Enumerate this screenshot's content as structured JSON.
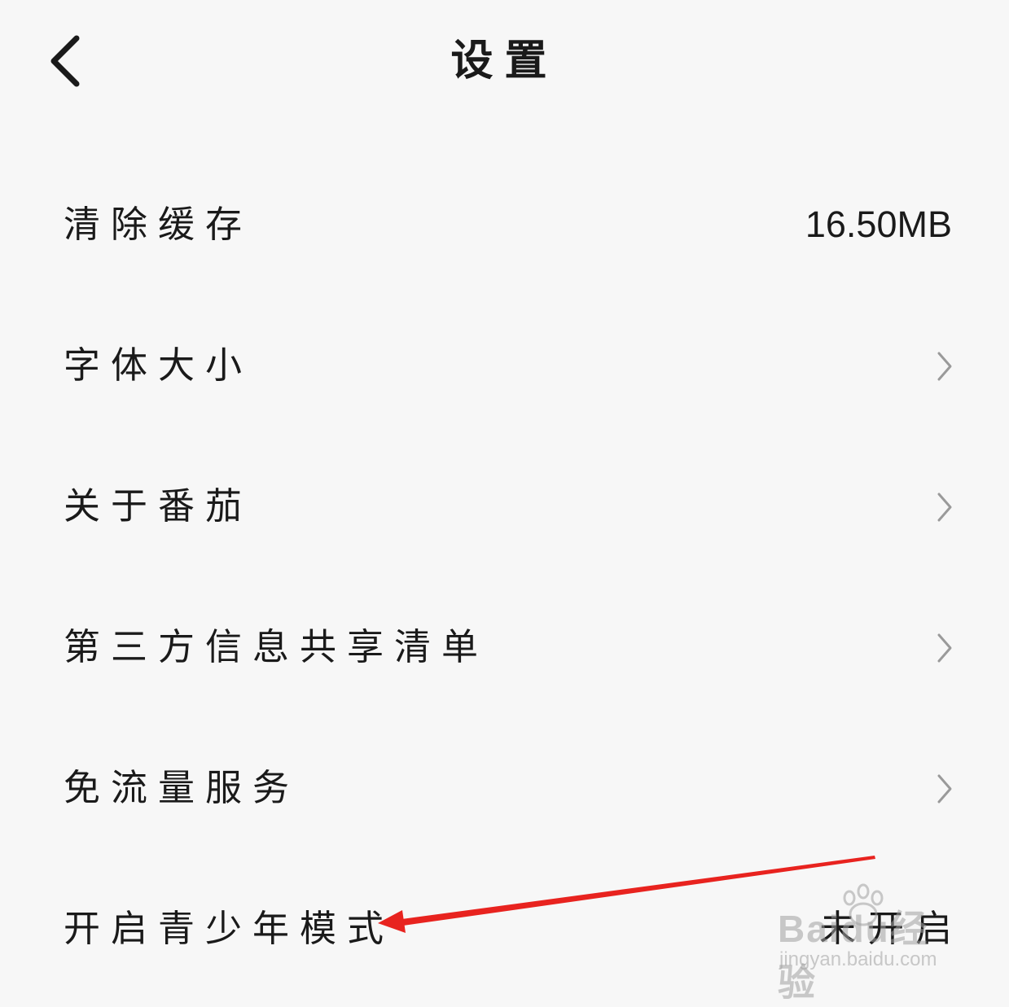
{
  "header": {
    "title": "设置",
    "back_icon": "chevron-left-icon"
  },
  "settings": [
    {
      "label": "清除缓存",
      "value": "16.50MB",
      "type": "value"
    },
    {
      "label": "字体大小",
      "type": "chevron"
    },
    {
      "label": "关于番茄",
      "type": "chevron"
    },
    {
      "label": "第三方信息共享清单",
      "type": "chevron"
    },
    {
      "label": "免流量服务",
      "type": "chevron"
    },
    {
      "label": "开启青少年模式",
      "value": "未开启",
      "type": "status"
    }
  ],
  "annotation": {
    "arrow_color": "#e8231f"
  },
  "watermark": {
    "logo": "Baidu经验",
    "url": "jingyan.baidu.com"
  }
}
